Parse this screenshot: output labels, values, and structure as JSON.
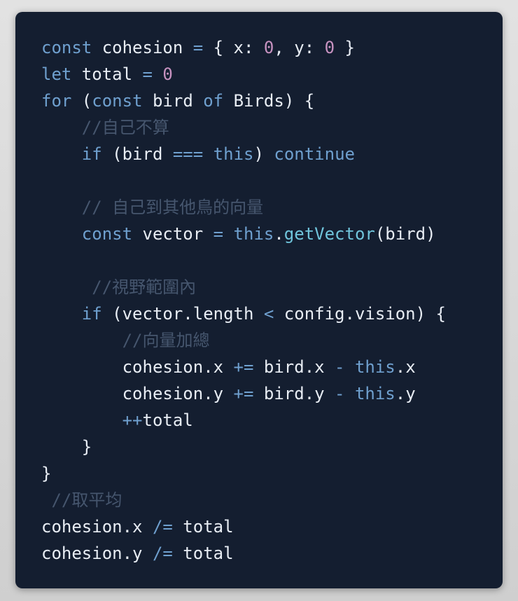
{
  "colors": {
    "background": "#d9d9d9",
    "card_background": "#141e30",
    "plain_text": "#e8edf4",
    "keyword": "#6fa0cf",
    "number": "#c792c0",
    "function": "#70c5dc",
    "comment": "#46566e"
  },
  "code": {
    "language": "javascript",
    "lines": [
      [
        {
          "t": "kw",
          "v": "const"
        },
        {
          "t": "txt",
          "v": " cohesion "
        },
        {
          "t": "op",
          "v": "="
        },
        {
          "t": "txt",
          "v": " { x: "
        },
        {
          "t": "num",
          "v": "0"
        },
        {
          "t": "txt",
          "v": ", y: "
        },
        {
          "t": "num",
          "v": "0"
        },
        {
          "t": "txt",
          "v": " }"
        }
      ],
      [
        {
          "t": "kw",
          "v": "let"
        },
        {
          "t": "txt",
          "v": " total "
        },
        {
          "t": "op",
          "v": "="
        },
        {
          "t": "txt",
          "v": " "
        },
        {
          "t": "num",
          "v": "0"
        }
      ],
      [
        {
          "t": "kw",
          "v": "for"
        },
        {
          "t": "txt",
          "v": " ("
        },
        {
          "t": "kw",
          "v": "const"
        },
        {
          "t": "txt",
          "v": " bird "
        },
        {
          "t": "kw",
          "v": "of"
        },
        {
          "t": "txt",
          "v": " Birds) {"
        }
      ],
      [
        {
          "t": "txt",
          "v": "    "
        },
        {
          "t": "cmt",
          "v": "//自己不算"
        }
      ],
      [
        {
          "t": "txt",
          "v": "    "
        },
        {
          "t": "kw",
          "v": "if"
        },
        {
          "t": "txt",
          "v": " (bird "
        },
        {
          "t": "op",
          "v": "==="
        },
        {
          "t": "txt",
          "v": " "
        },
        {
          "t": "kw",
          "v": "this"
        },
        {
          "t": "txt",
          "v": ") "
        },
        {
          "t": "kw",
          "v": "continue"
        }
      ],
      [],
      [
        {
          "t": "txt",
          "v": "    "
        },
        {
          "t": "cmt",
          "v": "// 自己到其他鳥的向量"
        }
      ],
      [
        {
          "t": "txt",
          "v": "    "
        },
        {
          "t": "kw",
          "v": "const"
        },
        {
          "t": "txt",
          "v": " vector "
        },
        {
          "t": "op",
          "v": "="
        },
        {
          "t": "txt",
          "v": " "
        },
        {
          "t": "kw",
          "v": "this"
        },
        {
          "t": "txt",
          "v": "."
        },
        {
          "t": "fn",
          "v": "getVector"
        },
        {
          "t": "txt",
          "v": "(bird)"
        }
      ],
      [],
      [
        {
          "t": "txt",
          "v": "     "
        },
        {
          "t": "cmt",
          "v": "//視野範圍內"
        }
      ],
      [
        {
          "t": "txt",
          "v": "    "
        },
        {
          "t": "kw",
          "v": "if"
        },
        {
          "t": "txt",
          "v": " (vector.length "
        },
        {
          "t": "op",
          "v": "<"
        },
        {
          "t": "txt",
          "v": " config.vision) {"
        }
      ],
      [
        {
          "t": "txt",
          "v": "        "
        },
        {
          "t": "cmt",
          "v": "//向量加總"
        }
      ],
      [
        {
          "t": "txt",
          "v": "        cohesion.x "
        },
        {
          "t": "op",
          "v": "+="
        },
        {
          "t": "txt",
          "v": " bird.x "
        },
        {
          "t": "op",
          "v": "-"
        },
        {
          "t": "txt",
          "v": " "
        },
        {
          "t": "kw",
          "v": "this"
        },
        {
          "t": "txt",
          "v": ".x"
        }
      ],
      [
        {
          "t": "txt",
          "v": "        cohesion.y "
        },
        {
          "t": "op",
          "v": "+="
        },
        {
          "t": "txt",
          "v": " bird.y "
        },
        {
          "t": "op",
          "v": "-"
        },
        {
          "t": "txt",
          "v": " "
        },
        {
          "t": "kw",
          "v": "this"
        },
        {
          "t": "txt",
          "v": ".y"
        }
      ],
      [
        {
          "t": "txt",
          "v": "        "
        },
        {
          "t": "op",
          "v": "++"
        },
        {
          "t": "txt",
          "v": "total"
        }
      ],
      [
        {
          "t": "txt",
          "v": "    }"
        }
      ],
      [
        {
          "t": "txt",
          "v": "}"
        }
      ],
      [
        {
          "t": "txt",
          "v": " "
        },
        {
          "t": "cmt",
          "v": "//取平均"
        }
      ],
      [
        {
          "t": "txt",
          "v": "cohesion.x "
        },
        {
          "t": "op",
          "v": "/="
        },
        {
          "t": "txt",
          "v": " total"
        }
      ],
      [
        {
          "t": "txt",
          "v": "cohesion.y "
        },
        {
          "t": "op",
          "v": "/="
        },
        {
          "t": "txt",
          "v": " total"
        }
      ]
    ]
  }
}
